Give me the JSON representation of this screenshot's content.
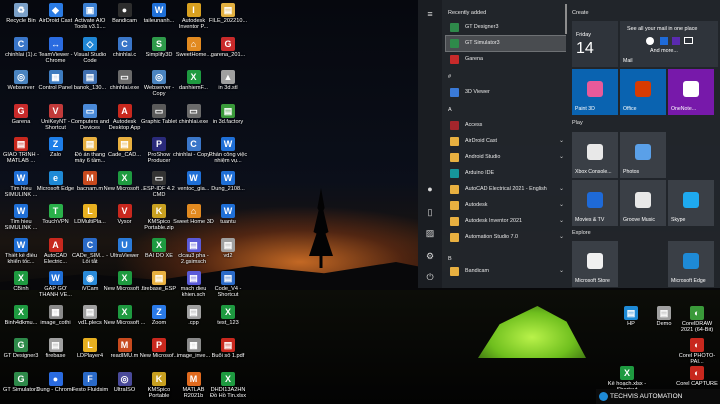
{
  "desktop": {
    "icons": [
      {
        "label": "Recycle Bin",
        "color": "#7aa0c8",
        "glyph": "♻"
      },
      {
        "label": "AirDroid Cast",
        "color": "#2a7be4",
        "glyph": "◆"
      },
      {
        "label": "Activate AIO Tools v3.1....",
        "color": "#3b7fd1",
        "glyph": "▣"
      },
      {
        "label": "Bandicam",
        "color": "#2d2d2d",
        "glyph": "●"
      },
      {
        "label": "taileunanh...",
        "color": "#1f6fd6",
        "glyph": "W"
      },
      {
        "label": "Autodesk Inventor P...",
        "color": "#d8a020",
        "glyph": "I"
      },
      {
        "label": "FILE_202210...",
        "color": "#e2b040",
        "glyph": "▤"
      },
      {
        "label": "chinhlai (1).c",
        "color": "#3a76c8",
        "glyph": "C"
      },
      {
        "label": "TeamViewer - Chrome",
        "color": "#2a6be0",
        "glyph": "↔"
      },
      {
        "label": "Visual Studio Code",
        "color": "#1f86d4",
        "glyph": "◇"
      },
      {
        "label": "chinhlai.c",
        "color": "#3a76c8",
        "glyph": "C"
      },
      {
        "label": "Simplify3D",
        "color": "#2e9a4a",
        "glyph": "S"
      },
      {
        "label": "SweetHome...",
        "color": "#e28a20",
        "glyph": "⌂"
      },
      {
        "label": "garena_201...",
        "color": "#c82a2a",
        "glyph": "G"
      },
      {
        "label": "Webserver",
        "color": "#4a84c0",
        "glyph": "◎"
      },
      {
        "label": "Control Panel",
        "color": "#3e7cc0",
        "glyph": "▦"
      },
      {
        "label": "banok_130...",
        "color": "#3f6fb0",
        "glyph": "▤"
      },
      {
        "label": "chinhlai.exe",
        "color": "#6a6a6a",
        "glyph": "▭"
      },
      {
        "label": "Webserver - Copy",
        "color": "#4a84c0",
        "glyph": "◎"
      },
      {
        "label": "danhiemF...",
        "color": "#1e9a40",
        "glyph": "X"
      },
      {
        "label": "in 3d.stl",
        "color": "#a0a0a0",
        "glyph": "▲"
      },
      {
        "label": "Garena",
        "color": "#c82a2a",
        "glyph": "G"
      },
      {
        "label": "UniKeyNT - Shortcut",
        "color": "#c23a3a",
        "glyph": "V"
      },
      {
        "label": "Computers and Devices",
        "color": "#4a8ad8",
        "glyph": "▭"
      },
      {
        "label": "Autodesk Desktop App",
        "color": "#c8281e",
        "glyph": "A"
      },
      {
        "label": "Graphic Tablet",
        "color": "#5a5a5a",
        "glyph": "▭"
      },
      {
        "label": "chinhlai.exe",
        "color": "#6a6a6a",
        "glyph": "▭"
      },
      {
        "label": "in 3d.factory",
        "color": "#3a9a3a",
        "glyph": "▤"
      },
      {
        "label": "GIÁO TRÌNH - MATLAB ...",
        "color": "#c8281e",
        "glyph": "▤"
      },
      {
        "label": "Zalo",
        "color": "#1e7ee8",
        "glyph": "Z"
      },
      {
        "label": "Đồ án thang máy 6 tầm...",
        "color": "#e8b040",
        "glyph": "▤"
      },
      {
        "label": "Cade_CAD...",
        "color": "#e8b040",
        "glyph": "▤"
      },
      {
        "label": "ProShow Producer",
        "color": "#2a2a7a",
        "glyph": "P"
      },
      {
        "label": "chinhlai - Copy.c",
        "color": "#3a76c8",
        "glyph": "C"
      },
      {
        "label": "Phần công việc nhiệm vụ...",
        "color": "#1f6fd6",
        "glyph": "W"
      },
      {
        "label": "Tim hieu SIMULINK ...",
        "color": "#1f6fd6",
        "glyph": "W"
      },
      {
        "label": "Microsoft Edge",
        "color": "#1f8ad6",
        "glyph": "e"
      },
      {
        "label": "bacnam.m",
        "color": "#c84a1e",
        "glyph": "M"
      },
      {
        "label": "New Microsoft ...",
        "color": "#1e9a40",
        "glyph": "X"
      },
      {
        "label": "ESP-IDF 4.2 CMD",
        "color": "#333333",
        "glyph": "▭"
      },
      {
        "label": "ventoc_gia...",
        "color": "#1f6fd6",
        "glyph": "W"
      },
      {
        "label": "Dung_2108...",
        "color": "#1f6fd6",
        "glyph": "W"
      },
      {
        "label": "Tim hieu SIMULINK ...",
        "color": "#1f6fd6",
        "glyph": "W"
      },
      {
        "label": "TouchVPN",
        "color": "#2ab04a",
        "glyph": "T"
      },
      {
        "label": "LDMultiPla...",
        "color": "#e8b020",
        "glyph": "L"
      },
      {
        "label": "Vysor",
        "color": "#c8281e",
        "glyph": "V"
      },
      {
        "label": "KMSpico Portable.zip",
        "color": "#c8a020",
        "glyph": "K"
      },
      {
        "label": "Sweet Home 3D",
        "color": "#e28a20",
        "glyph": "⌂"
      },
      {
        "label": "tuantu",
        "color": "#1f6fd6",
        "glyph": "W"
      },
      {
        "label": "Thiết kế điều khiển tốc...",
        "color": "#1f6fd6",
        "glyph": "W"
      },
      {
        "label": "AutoCAD Electric...",
        "color": "#c8281e",
        "glyph": "A"
      },
      {
        "label": "CADe_SIM... - Lối tắt",
        "color": "#2a6ac8",
        "glyph": "C"
      },
      {
        "label": "UltraViewer",
        "color": "#2a7ad8",
        "glyph": "U"
      },
      {
        "label": "BAI DO XE",
        "color": "#1e9a40",
        "glyph": "X"
      },
      {
        "label": "clcau3 pha - 2.gsimsch",
        "color": "#5a5ad8",
        "glyph": "▤"
      },
      {
        "label": "vd2",
        "color": "#a0a0a0",
        "glyph": "▤"
      },
      {
        "label": "CBinh",
        "color": "#1e9a40",
        "glyph": "X"
      },
      {
        "label": "GÁP GỠ THANH VE...",
        "color": "#1f6fd6",
        "glyph": "W"
      },
      {
        "label": "iVCam",
        "color": "#2a8ad8",
        "glyph": "◉"
      },
      {
        "label": "New Microsoft ...",
        "color": "#1e9a40",
        "glyph": "X"
      },
      {
        "label": "firebase_ESP",
        "color": "#e8b040",
        "glyph": "▤"
      },
      {
        "label": "mach dieu khien.sch",
        "color": "#5a5ad8",
        "glyph": "▤"
      },
      {
        "label": "Code_V4 - Shortcut",
        "color": "#2a6ac8",
        "glyph": "▤"
      },
      {
        "label": "Binh4dkmu...",
        "color": "#1e9a40",
        "glyph": "X"
      },
      {
        "label": "image_cothi",
        "color": "#8a8a8a",
        "glyph": "▦"
      },
      {
        "label": "vd1.plecs",
        "color": "#a0a0a0",
        "glyph": "▤"
      },
      {
        "label": "New Microsoft ...",
        "color": "#1e9a40",
        "glyph": "X"
      },
      {
        "label": "Zoom",
        "color": "#2a7ae8",
        "glyph": "Z"
      },
      {
        "label": ".cpp",
        "color": "#a0a0a0",
        "glyph": "▤"
      },
      {
        "label": "test_123",
        "color": "#1e9a40",
        "glyph": "X"
      },
      {
        "label": "GT Designer3",
        "color": "#2e8a4a",
        "glyph": "G"
      },
      {
        "label": "firebase",
        "color": "#a0a0a0",
        "glyph": "▤"
      },
      {
        "label": "LDPlayer4",
        "color": "#e8b020",
        "glyph": "L"
      },
      {
        "label": "readIMU.m",
        "color": "#c84a1e",
        "glyph": "M"
      },
      {
        "label": "New Microsof...",
        "color": "#c8281e",
        "glyph": "P"
      },
      {
        "label": "image_inve...",
        "color": "#8a8a8a",
        "glyph": "▦"
      },
      {
        "label": "Buổi số 1.pdf",
        "color": "#c8281e",
        "glyph": "▤"
      },
      {
        "label": "GT Simulator3",
        "color": "#2e8a4a",
        "glyph": "G"
      },
      {
        "label": "Dung - Chrome",
        "color": "#2a6be0",
        "glyph": "●"
      },
      {
        "label": "Festo Fluidsim",
        "color": "#2a6ac8",
        "glyph": "F"
      },
      {
        "label": "UltraISO",
        "color": "#4a4a9a",
        "glyph": "◎"
      },
      {
        "label": "KMSpico Portable",
        "color": "#c8a020",
        "glyph": "K"
      },
      {
        "label": "MATLAB R2021b",
        "color": "#e06a1e",
        "glyph": "M"
      },
      {
        "label": "DHDI13A2HN Đồ Hồ Tin.xlsx",
        "color": "#1e9a40",
        "glyph": "X"
      }
    ],
    "right_icons": [
      {
        "label": "HP",
        "color": "#1e8ad6",
        "glyph": "▤"
      },
      {
        "label": "Demo",
        "color": "#a0a0a0",
        "glyph": "▤"
      },
      {
        "label": "CorelDRAW 2021 (64-Bit)",
        "color": "#3a9a3a",
        "glyph": "◐"
      },
      {
        "label": "Corel PHOTO-PAI...",
        "color": "#c8281e",
        "glyph": "◐"
      },
      {
        "label": "Kế hoạch.xlsx - Shortcut",
        "color": "#1e9a40",
        "glyph": "X"
      },
      {
        "label": "Corel CAPTURE ...",
        "color": "#c8281e",
        "glyph": "◐"
      }
    ]
  },
  "start_menu": {
    "rail_icons": [
      "menu-icon",
      "user-icon",
      "document-icon",
      "pictures-icon",
      "settings-icon",
      "power-icon"
    ],
    "rail_glyphs": [
      "≡",
      "●",
      "▯",
      "▨",
      "⚙",
      "⏻"
    ],
    "recently_added_label": "Recently added",
    "recent": [
      {
        "label": "GT Designer3",
        "color": "#2e8a4a"
      },
      {
        "label": "GT Simulator3",
        "color": "#2e8a4a"
      },
      {
        "label": "Garena",
        "color": "#c82a2a"
      }
    ],
    "hash_label": "#",
    "hash_apps": [
      {
        "label": "3D Viewer",
        "color": "#3a7ad8"
      }
    ],
    "a_label": "A",
    "a_apps": [
      {
        "label": "Access",
        "color": "#a4262c",
        "chev": ""
      },
      {
        "label": "AirDroid Cast",
        "color": "#e8b040",
        "chev": "⌄"
      },
      {
        "label": "Android Studio",
        "color": "#e8b040",
        "chev": "⌄"
      },
      {
        "label": "Arduino IDE",
        "color": "#16969c",
        "chev": ""
      },
      {
        "label": "AutoCAD Electrical 2021 - English",
        "color": "#e8b040",
        "chev": "⌄"
      },
      {
        "label": "Autodesk",
        "color": "#e8b040",
        "chev": "⌄"
      },
      {
        "label": "Autodesk Inventor 2021",
        "color": "#e8b040",
        "chev": "⌄"
      },
      {
        "label": "Automation Studio 7.0",
        "color": "#e8b040",
        "chev": "⌄"
      }
    ],
    "b_label": "B",
    "b_apps": [
      {
        "label": "Bandicam",
        "color": "#e8b040",
        "chev": "⌄"
      }
    ],
    "groups": {
      "create": "Create",
      "play": "Play",
      "explore": "Explore"
    },
    "calendar": {
      "day": "Friday",
      "date": "14"
    },
    "mail": {
      "headline": "See all your mail in one place",
      "more": "And more...",
      "label": "Mail"
    },
    "tiles_create": [
      {
        "label": "Paint 3D",
        "color": "#0a63b0",
        "icon": "#e85a9a"
      },
      {
        "label": "Office",
        "color": "#0a63b0",
        "icon": "#d83b01"
      },
      {
        "label": "OneNote...",
        "color": "#7719aa",
        "icon": "#ffffff"
      }
    ],
    "tiles_play": [
      {
        "label": "Xbox Console...",
        "color": "#3a3f46",
        "icon": "#e8e8e8"
      },
      {
        "label": "Photos",
        "color": "#3a3f46",
        "icon": "#5aa0e8"
      },
      {
        "label": "Movies & TV",
        "color": "#3a3f46",
        "icon": "#1e6ad8"
      },
      {
        "label": "Groove Music",
        "color": "#3a3f46",
        "icon": "#e8e8e8"
      },
      {
        "label": "Skype",
        "color": "#3a3f46",
        "icon": "#1eaaf0"
      }
    ],
    "tiles_explore": [
      {
        "label": "Microsoft Store",
        "color": "#3a3f46",
        "icon": "#f0f0f0"
      },
      {
        "label": "Microsoft Edge",
        "color": "#3a3f46",
        "icon": "#1e8ad6"
      }
    ]
  },
  "watermark": "TECHVIS AUTOMATION"
}
